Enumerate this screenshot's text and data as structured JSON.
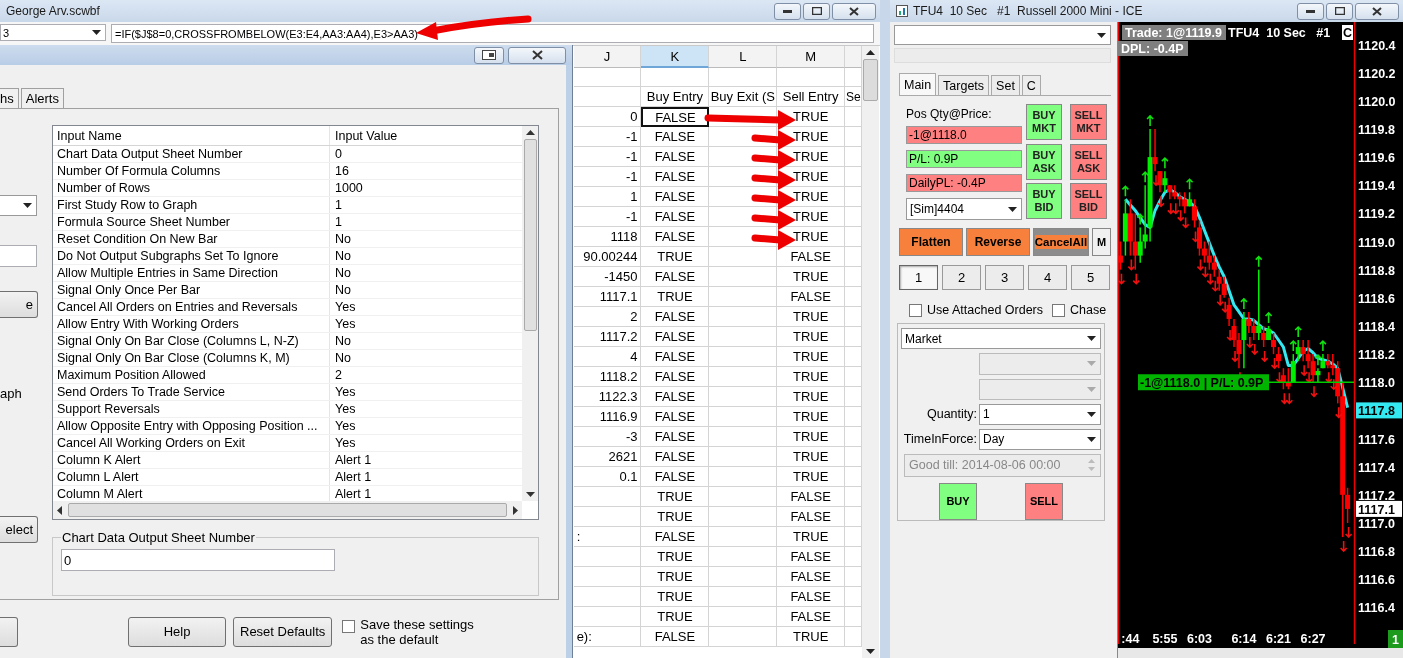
{
  "spreadsheet_window": {
    "title": "George Arv.scwbf",
    "name_box": "3",
    "formula": "=IF($J$8=0,CROSSFROMBELOW(E3:E4,AA3:AA4),E3>AA3)",
    "columns": [
      {
        "letter": "J",
        "selected": false
      },
      {
        "letter": "K",
        "heading": "Buy Entry",
        "selected": true
      },
      {
        "letter": "L",
        "heading": "Buy Exit (S",
        "selected": false
      },
      {
        "letter": "M",
        "heading": "Sell Entry",
        "selected": false
      }
    ],
    "column_n_heading": "Se",
    "rows": [
      {
        "j": "0",
        "k": "FALSE",
        "m": "TRUE",
        "selected": true
      },
      {
        "j": "-1",
        "k": "FALSE",
        "m": "TRUE",
        "selected": false
      },
      {
        "j": "-1",
        "k": "FALSE",
        "m": "TRUE",
        "selected": false
      },
      {
        "j": "-1",
        "k": "FALSE",
        "m": "TRUE",
        "selected": false
      },
      {
        "j": "1",
        "k": "FALSE",
        "m": "TRUE",
        "selected": false
      },
      {
        "j": "-1",
        "k": "FALSE",
        "m": "TRUE",
        "selected": false
      },
      {
        "j": "1118",
        "k": "FALSE",
        "m": "TRUE",
        "selected": false
      },
      {
        "j": "90.00244",
        "k": "TRUE",
        "m": "FALSE",
        "selected": false
      },
      {
        "j": "-1450",
        "k": "FALSE",
        "m": "TRUE",
        "selected": false
      },
      {
        "j": "1117.1",
        "k": "TRUE",
        "m": "FALSE",
        "selected": false
      },
      {
        "j": "2",
        "k": "FALSE",
        "m": "TRUE",
        "selected": false
      },
      {
        "j": "1117.2",
        "k": "FALSE",
        "m": "TRUE",
        "selected": false
      },
      {
        "j": "4",
        "k": "FALSE",
        "m": "TRUE",
        "selected": false
      },
      {
        "j": "1118.2",
        "k": "FALSE",
        "m": "TRUE",
        "selected": false
      },
      {
        "j": "1122.3",
        "k": "FALSE",
        "m": "TRUE",
        "selected": false
      },
      {
        "j": "1116.9",
        "k": "FALSE",
        "m": "TRUE",
        "selected": false
      },
      {
        "j": "-3",
        "k": "FALSE",
        "m": "TRUE",
        "selected": false
      },
      {
        "j": "2621",
        "k": "FALSE",
        "m": "TRUE",
        "selected": false
      },
      {
        "j": "0.1",
        "k": "FALSE",
        "m": "TRUE",
        "selected": false
      },
      {
        "k": "TRUE",
        "m": "FALSE",
        "selected": false
      },
      {
        "k": "TRUE",
        "m": "FALSE",
        "selected": false
      },
      {
        "overflow": ":",
        "k": "FALSE",
        "m": "TRUE",
        "selected": false
      },
      {
        "k": "TRUE",
        "m": "FALSE",
        "selected": false
      },
      {
        "k": "TRUE",
        "m": "FALSE",
        "selected": false
      },
      {
        "k": "TRUE",
        "m": "FALSE",
        "selected": false
      },
      {
        "k": "TRUE",
        "m": "FALSE",
        "selected": false
      },
      {
        "overflow": "e):",
        "k": "FALSE",
        "m": "TRUE",
        "selected": false
      }
    ]
  },
  "dialog": {
    "tabs": [
      {
        "label": "hs",
        "selected": false
      },
      {
        "label": "Alerts",
        "selected": false
      }
    ],
    "side_controls": [
      {
        "kind": "combo"
      },
      {
        "kind": "field"
      },
      {
        "kind": "button",
        "label": "e"
      },
      {
        "kind": "text",
        "label": "aph"
      },
      {
        "kind": "button",
        "label": "elect"
      }
    ],
    "inputs_table": {
      "columns": [
        "Input Name",
        "Input Value"
      ],
      "rows": [
        {
          "name": "Chart Data Output Sheet Number",
          "value": "0"
        },
        {
          "name": "Number Of Formula Columns",
          "value": "16"
        },
        {
          "name": "Number of Rows",
          "value": "1000"
        },
        {
          "name": "First Study Row to Graph",
          "value": "1"
        },
        {
          "name": "Formula Source Sheet Number",
          "value": "1"
        },
        {
          "name": "Reset Condition On New Bar",
          "value": "No"
        },
        {
          "name": "Do Not Output Subgraphs Set To Ignore",
          "value": "No"
        },
        {
          "name": "Allow Multiple Entries in Same Direction",
          "value": "No"
        },
        {
          "name": "Signal Only Once Per Bar",
          "value": "No"
        },
        {
          "name": "Cancel All Orders on Entries and Reversals",
          "value": "Yes"
        },
        {
          "name": "Allow Entry With Working Orders",
          "value": "Yes"
        },
        {
          "name": "Signal Only On Bar Close (Columns L, N-Z)",
          "value": "No"
        },
        {
          "name": "Signal Only On Bar Close (Columns K, M)",
          "value": "No"
        },
        {
          "name": "Maximum Position Allowed",
          "value": "2"
        },
        {
          "name": "Send Orders To Trade Service",
          "value": "Yes"
        },
        {
          "name": "Support Reversals",
          "value": "Yes"
        },
        {
          "name": "Allow Opposite Entry with Opposing Position ...",
          "value": "Yes"
        },
        {
          "name": "Cancel All Working Orders on Exit",
          "value": "Yes"
        },
        {
          "name": "Column K Alert",
          "value": "Alert 1"
        },
        {
          "name": "Column L Alert",
          "value": "Alert 1"
        },
        {
          "name": "Column M Alert",
          "value": "Alert 1"
        }
      ]
    },
    "group": {
      "legend": "Chart Data Output Sheet Number",
      "value": "0"
    },
    "buttons": [
      {
        "label": "Help"
      },
      {
        "label": "Reset Defaults"
      }
    ],
    "save_default": {
      "label": "Save these settings as the default",
      "checked": false
    }
  },
  "trade_window": {
    "title": "TFU4  10 Sec   #1  Russell 2000 Mini - ICE",
    "panel": {
      "tabs": [
        {
          "label": "Main",
          "selected": true
        },
        {
          "label": "Targets",
          "selected": false
        },
        {
          "label": "Set",
          "selected": false
        },
        {
          "label": "C",
          "selected": false
        }
      ],
      "position_label": "Pos Qty@Price:",
      "fields": [
        {
          "text": "-1@1118.0",
          "color": "#ff8080"
        },
        {
          "text": "P/L: 0.9P",
          "color": "#80ff80"
        },
        {
          "text": "DailyPL: -0.4P",
          "color": "#ff8080"
        }
      ],
      "account": "[Sim]4404",
      "order_buttons": [
        {
          "label": "BUY MKT",
          "color": "#80ff80"
        },
        {
          "label": "SELL MKT",
          "color": "#ff8080"
        },
        {
          "label": "BUY ASK",
          "color": "#80ff80"
        },
        {
          "label": "SELL ASK",
          "color": "#ff8080"
        },
        {
          "label": "BUY BID",
          "color": "#80ff80"
        },
        {
          "label": "SELL BID",
          "color": "#ff8080"
        }
      ],
      "actions": [
        {
          "label": "Flatten",
          "kind": "primary"
        },
        {
          "label": "Reverse",
          "kind": "primary"
        },
        {
          "label": "CancelAll",
          "kind": "cancel"
        },
        {
          "label": "M",
          "kind": "plain"
        }
      ],
      "quantity_presets": [
        {
          "label": "1",
          "selected": true
        },
        {
          "label": "2",
          "selected": false
        },
        {
          "label": "3",
          "selected": false
        },
        {
          "label": "4",
          "selected": false
        },
        {
          "label": "5",
          "selected": false
        }
      ],
      "checkboxes": [
        {
          "label": "Use Attached Orders",
          "checked": false
        },
        {
          "label": "Chase",
          "checked": false
        }
      ],
      "order_type": "Market",
      "quantity": {
        "label": "Quantity:",
        "value": "1"
      },
      "time_in_force": {
        "label": "TimeInForce:",
        "value": "Day"
      },
      "good_till": {
        "value": "Good till: 2014-08-06 00:00",
        "disabled": true
      },
      "submit": [
        {
          "label": "BUY",
          "color": "#80ff80"
        },
        {
          "label": "SELL",
          "color": "#ff8080"
        }
      ]
    },
    "chart": {
      "trade_label": "Trade: 1@1119.9",
      "symbol_label": "TFU4  10 Sec   #1",
      "corner_label": "C",
      "daily_pl_label": "DPL: -0.4P",
      "position_line_label": "-1@1118.0 | P/L: 0.9P",
      "price_labels": [
        {
          "text": "1117.8",
          "color": "#33e8f0"
        },
        {
          "text": "1117.1",
          "color": "#ffffff"
        }
      ],
      "bar_counter": "1",
      "chart_data": {
        "type": "candlestick",
        "ylim": [
          1116.14,
          1120.56
        ],
        "categories": [
          null,
          null,
          ":44",
          null,
          null,
          null,
          null,
          null,
          null,
          "5:55",
          null,
          null,
          null,
          null,
          null,
          null,
          "6:03",
          null,
          null,
          null,
          null,
          null,
          null,
          null,
          null,
          "6:14",
          null,
          null,
          null,
          null,
          null,
          null,
          "6:21",
          null,
          null,
          null,
          null,
          null,
          null,
          "6:27",
          null,
          null,
          null,
          null,
          null,
          null,
          null,
          null
        ],
        "ohlc": [
          [
            1118.9,
            1119.0,
            1118.8,
            1118.85
          ],
          [
            1119.0,
            1119.3,
            1118.9,
            1119.2
          ],
          [
            1119.2,
            1119.3,
            1118.9,
            1119.0
          ],
          [
            1119.0,
            1119.2,
            1118.8,
            1118.9
          ],
          [
            1118.9,
            1119.1,
            1118.85,
            1119.0
          ],
          [
            1119.0,
            1119.4,
            1118.95,
            1119.05
          ],
          [
            1119.1,
            1119.8,
            1119.0,
            1119.6
          ],
          [
            1119.6,
            1119.8,
            1119.5,
            1119.55
          ],
          [
            1119.5,
            1119.5,
            1119.35,
            1119.4
          ],
          [
            1119.4,
            1119.5,
            1119.35,
            1119.45
          ],
          [
            1119.4,
            1119.4,
            1119.3,
            1119.35
          ],
          [
            1119.35,
            1119.4,
            1119.3,
            1119.32
          ],
          [
            1119.32,
            1119.35,
            1119.25,
            1119.3
          ],
          [
            1119.3,
            1119.35,
            1119.2,
            1119.25
          ],
          [
            1119.25,
            1119.35,
            1119.25,
            1119.3
          ],
          [
            1119.25,
            1119.3,
            1119.1,
            1119.15
          ],
          [
            1119.1,
            1119.15,
            1118.9,
            1118.95
          ],
          [
            1118.95,
            1119.0,
            1118.85,
            1118.9
          ],
          [
            1118.9,
            1119.0,
            1118.8,
            1118.85
          ],
          [
            1118.85,
            1118.9,
            1118.75,
            1118.8
          ],
          [
            1118.75,
            1118.8,
            1118.65,
            1118.7
          ],
          [
            1118.7,
            1118.75,
            1118.6,
            1118.62
          ],
          [
            1118.55,
            1118.6,
            1118.4,
            1118.45
          ],
          [
            1118.4,
            1118.45,
            1118.25,
            1118.3
          ],
          [
            1118.3,
            1118.35,
            1118.1,
            1118.2
          ],
          [
            1118.3,
            1118.5,
            1118.1,
            1118.45
          ],
          [
            1118.45,
            1118.5,
            1118.35,
            1118.4
          ],
          [
            1118.4,
            1118.45,
            1118.3,
            1118.35
          ],
          [
            1118.35,
            1118.8,
            1118.3,
            1118.4
          ],
          [
            1118.35,
            1118.4,
            1118.25,
            1118.3
          ],
          [
            1118.3,
            1118.4,
            1118.3,
            1118.38
          ],
          [
            1118.3,
            1118.35,
            1118.2,
            1118.25
          ],
          [
            1118.2,
            1118.25,
            1118.1,
            1118.15
          ],
          [
            1118.05,
            1118.1,
            1117.95,
            1118.0
          ],
          [
            1118.0,
            1118.1,
            1117.95,
            1117.97
          ],
          [
            1118.0,
            1118.2,
            1118.0,
            1118.15
          ],
          [
            1118.2,
            1118.3,
            1118.15,
            1118.25
          ],
          [
            1118.25,
            1118.3,
            1118.15,
            1118.2
          ],
          [
            1118.2,
            1118.3,
            1118.1,
            1118.15
          ],
          [
            1118.15,
            1118.2,
            1118.0,
            1118.05
          ],
          [
            1118.05,
            1118.1,
            1118.0,
            1118.08
          ],
          [
            1118.1,
            1118.2,
            1118.1,
            1118.15
          ],
          [
            1118.15,
            1118.2,
            1118.1,
            1118.12
          ],
          [
            1118.12,
            1118.2,
            1118.05,
            1118.1
          ],
          [
            1118.1,
            1118.15,
            1117.85,
            1117.9
          ],
          [
            1117.9,
            1118.0,
            1116.9,
            1117.2
          ],
          [
            1117.2,
            1117.25,
            1117.0,
            1117.1
          ],
          null
        ],
        "series": [
          {
            "type": "line",
            "color": "#33e8f0",
            "values": [
              null,
              1119.3,
              1119.26,
              1119.22,
              1119.17,
              1119.12,
              1119.1,
              1119.22,
              1119.29,
              1119.35,
              1119.37,
              1119.35,
              1119.32,
              1119.3,
              1119.28,
              1119.25,
              1119.17,
              1119.08,
              1118.99,
              1118.9,
              1118.82,
              1118.75,
              1118.65,
              1118.55,
              1118.5,
              1118.45,
              1118.45,
              1118.44,
              1118.41,
              1118.38,
              1118.37,
              1118.35,
              1118.3,
              1118.25,
              1118.12,
              1118.12,
              1118.17,
              1118.22,
              1118.24,
              1118.21,
              1118.17,
              1118.16,
              1118.15,
              1118.13,
              1118.1,
              1117.96,
              1117.82,
              null
            ]
          }
        ],
        "yticks": [
          {
            "value": 1120.4,
            "label": "1120.4"
          },
          {
            "value": 1120.2,
            "label": "1120.2"
          },
          {
            "value": 1120.0,
            "label": "1120.0"
          },
          {
            "value": 1119.8,
            "label": "1119.8"
          },
          {
            "value": 1119.6,
            "label": "1119.6"
          },
          {
            "value": 1119.4,
            "label": "1119.4"
          },
          {
            "value": 1119.2,
            "label": "1119.2"
          },
          {
            "value": 1119.0,
            "label": "1119.0"
          },
          {
            "value": 1118.8,
            "label": "1118.8"
          },
          {
            "value": 1118.6,
            "label": "1118.6"
          },
          {
            "value": 1118.4,
            "label": "1118.4"
          },
          {
            "value": 1118.2,
            "label": "1118.2"
          },
          {
            "value": 1118.0,
            "label": "1118.0"
          },
          {
            "value": 1117.6,
            "label": "1117.6"
          },
          {
            "value": 1117.4,
            "label": "1117.4"
          },
          {
            "value": 1117.2,
            "label": "1117.2"
          },
          {
            "value": 1117.0,
            "label": "1117.0"
          },
          {
            "value": 1116.8,
            "label": "1116.8"
          },
          {
            "value": 1116.6,
            "label": "1116.6"
          },
          {
            "value": 1116.4,
            "label": "1116.4"
          }
        ]
      }
    }
  }
}
